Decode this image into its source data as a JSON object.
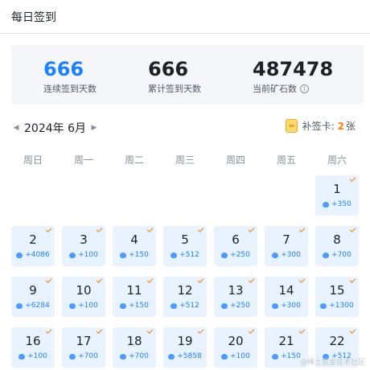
{
  "header": {
    "title": "每日签到"
  },
  "stats": [
    {
      "value": "666",
      "label": "连续签到天数",
      "accent": true,
      "info": false
    },
    {
      "value": "666",
      "label": "累计签到天数",
      "accent": false,
      "info": false
    },
    {
      "value": "487478",
      "label": "当前矿石数",
      "accent": false,
      "info": true
    }
  ],
  "month": {
    "label": "2024年 6月",
    "prev_icon": "triangle-left-icon",
    "next_icon": "triangle-right-icon"
  },
  "makeup": {
    "label": "补签卡:",
    "count": "2",
    "unit": "张",
    "icon": "makeup-card-icon"
  },
  "weekdays": [
    "周日",
    "周一",
    "周二",
    "周三",
    "周四",
    "周五",
    "周六"
  ],
  "leading_blanks": 6,
  "days": [
    {
      "day": "1",
      "reward": "+350"
    },
    {
      "day": "2",
      "reward": "+4086"
    },
    {
      "day": "3",
      "reward": "+100"
    },
    {
      "day": "4",
      "reward": "+150"
    },
    {
      "day": "5",
      "reward": "+512"
    },
    {
      "day": "6",
      "reward": "+250"
    },
    {
      "day": "7",
      "reward": "+300"
    },
    {
      "day": "8",
      "reward": "+700"
    },
    {
      "day": "9",
      "reward": "+6284"
    },
    {
      "day": "10",
      "reward": "+100"
    },
    {
      "day": "11",
      "reward": "+150"
    },
    {
      "day": "12",
      "reward": "+512"
    },
    {
      "day": "13",
      "reward": "+250"
    },
    {
      "day": "14",
      "reward": "+300"
    },
    {
      "day": "15",
      "reward": "+1300"
    },
    {
      "day": "16",
      "reward": "+100"
    },
    {
      "day": "17",
      "reward": "+700"
    },
    {
      "day": "18",
      "reward": "+700"
    },
    {
      "day": "19",
      "reward": "+5858"
    },
    {
      "day": "20",
      "reward": "+100"
    },
    {
      "day": "21",
      "reward": "+150"
    },
    {
      "day": "22",
      "reward": "+512"
    }
  ],
  "watermark": "@稀土掘金技术社区",
  "colors": {
    "accent": "#1e80ff",
    "cell_bg": "#e8f3ff",
    "check": "#ff7d00"
  }
}
